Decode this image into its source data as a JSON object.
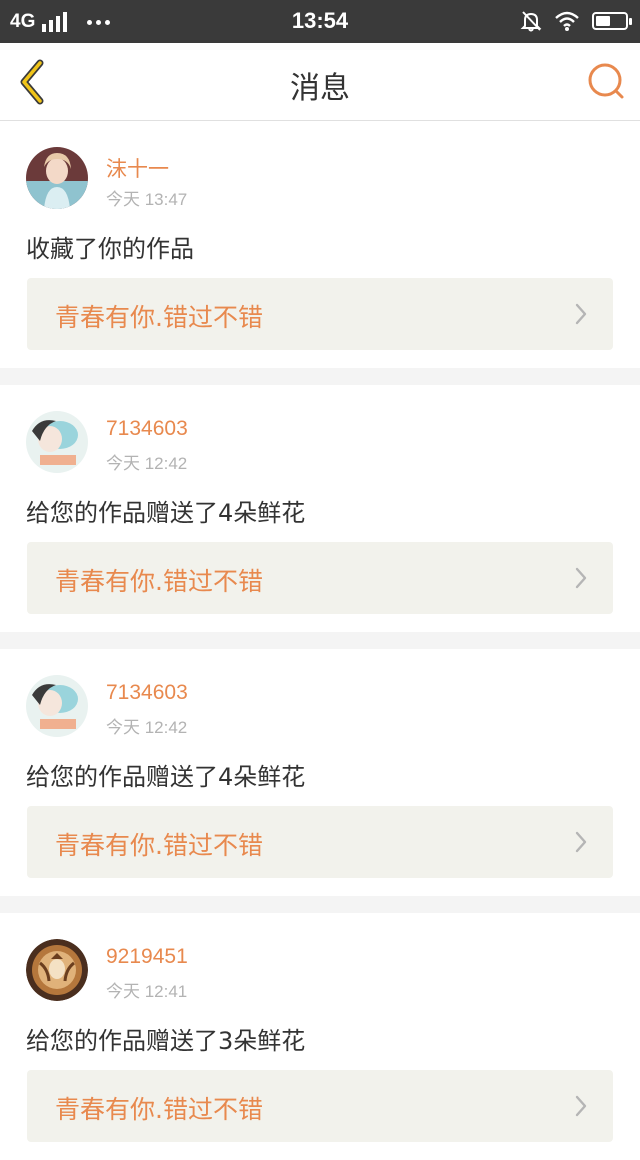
{
  "status_bar": {
    "network": "4G",
    "time": "13:54",
    "battery_level": 0.5,
    "icons": [
      "signal-icon",
      "more-dots-icon",
      "mute-bell-icon",
      "wifi-icon",
      "battery-icon"
    ]
  },
  "nav": {
    "title": "消息",
    "back_icon": "chevron-left-icon",
    "search_icon": "search-icon"
  },
  "colors": {
    "accent": "#e8894e",
    "nav_back": "#f0c419",
    "link_bg": "#f2f2ec"
  },
  "messages": [
    {
      "username": "沫十一",
      "time": "今天 13:47",
      "action": "收藏了你的作品",
      "work_title": "青春有你.错过不错",
      "avatar": "portrait-photo"
    },
    {
      "username": "7134603",
      "time": "今天 12:42",
      "action": "给您的作品赠送了4朵鲜花",
      "work_title": "青春有你.错过不错",
      "avatar": "portrait-photo"
    },
    {
      "username": "7134603",
      "time": "今天 12:42",
      "action": "给您的作品赠送了4朵鲜花",
      "work_title": "青春有你.错过不错",
      "avatar": "portrait-photo"
    },
    {
      "username": "9219451",
      "time": "今天 12:41",
      "action": "给您的作品赠送了3朵鲜花",
      "work_title": "青春有你.错过不错",
      "avatar": "logo-avatar"
    }
  ]
}
